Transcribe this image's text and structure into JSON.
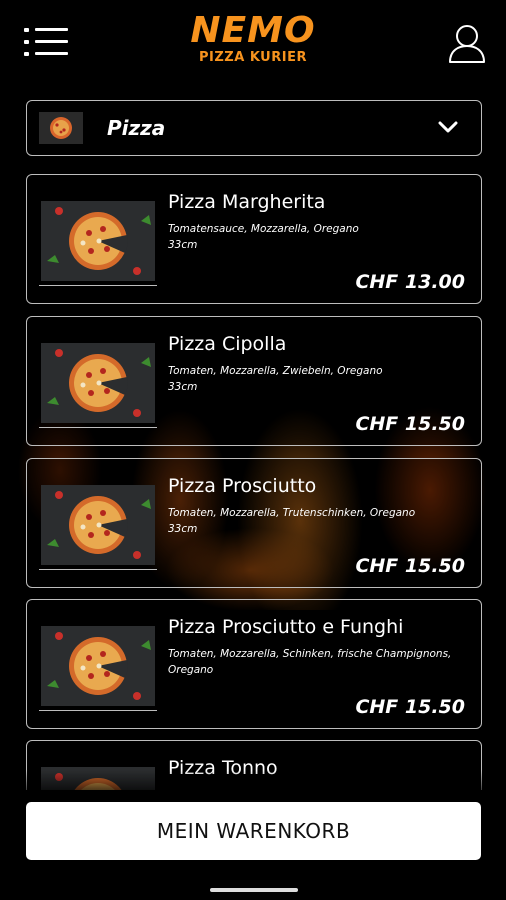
{
  "header": {
    "logo_line1": "NEMO",
    "logo_line2": "PIZZA KURIER",
    "menu_icon": "menu-icon",
    "user_icon": "user-icon"
  },
  "category": {
    "selected": "Pizza",
    "chevron_icon": "chevron-down-icon"
  },
  "products": [
    {
      "name": "Pizza Margherita",
      "desc": "Tomatensauce, Mozzarella, Oregano",
      "size": "33cm",
      "price": "CHF 13.00"
    },
    {
      "name": "Pizza Cipolla",
      "desc": "Tomaten, Mozzarella, Zwiebeln, Oregano",
      "size": "33cm",
      "price": "CHF 15.50"
    },
    {
      "name": "Pizza Prosciutto",
      "desc": "Tomaten, Mozzarella, Trutenschinken, Oregano",
      "size": "33cm",
      "price": "CHF 15.50"
    },
    {
      "name": "Pizza Prosciutto e Funghi",
      "desc": "Tomaten, Mozzarella, Schinken, frische Champignons,",
      "size": "Oregano",
      "price": "CHF 15.50"
    },
    {
      "name": "Pizza Tonno",
      "desc": "",
      "size": "",
      "price": ""
    }
  ],
  "cart": {
    "label": "MEIN WARENKORB"
  },
  "colors": {
    "brand": "#f7931e",
    "background": "#000000",
    "card_border": "#bdbdbd"
  }
}
